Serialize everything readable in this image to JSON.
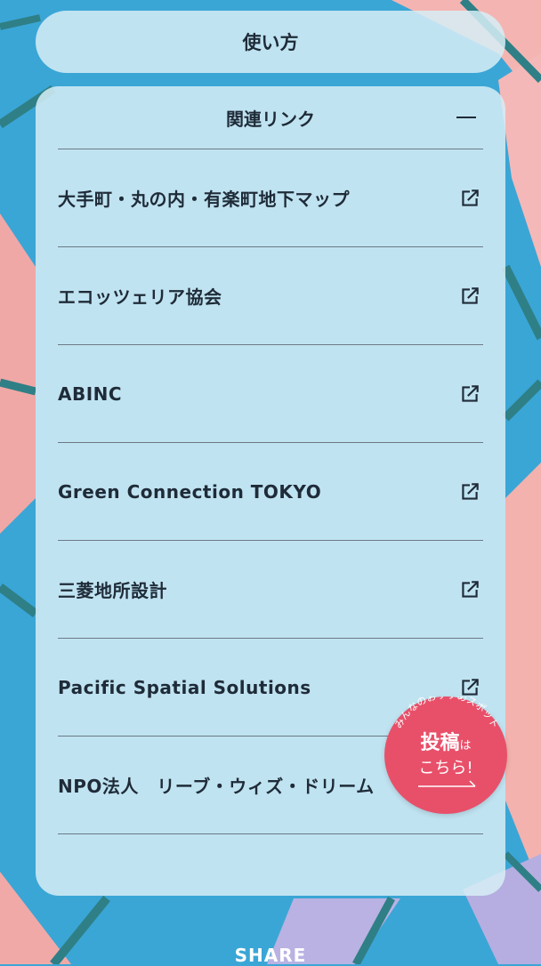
{
  "howto": {
    "label": "使い方"
  },
  "related": {
    "title": "関連リンク",
    "toggle_icon": "minus-icon",
    "items": [
      {
        "label": "大手町・丸の内・有楽町地下マップ",
        "icon": "external-link-icon"
      },
      {
        "label": "エコッツェリア協会",
        "icon": "external-link-icon"
      },
      {
        "label": "ABINC",
        "icon": "external-link-icon"
      },
      {
        "label": "Green Connection TOKYO",
        "icon": "external-link-icon"
      },
      {
        "label": "三菱地所設計",
        "icon": "external-link-icon"
      },
      {
        "label": "Pacific Spatial Solutions",
        "icon": "external-link-icon"
      },
      {
        "label": "NPO法人　リーブ・ウィズ・ドリーム",
        "icon": ""
      }
    ]
  },
  "post_badge": {
    "arc_text": "みんなのおすすめスポット",
    "main": "投稿",
    "particle": "は",
    "sub": "こちら!",
    "arrow_icon": "arrow-right-icon"
  },
  "share": {
    "label": "SHARE"
  },
  "colors": {
    "background_blue": "#3aa6d6",
    "accent_pink": "#e8506a",
    "text_dark": "#1f2b38"
  }
}
